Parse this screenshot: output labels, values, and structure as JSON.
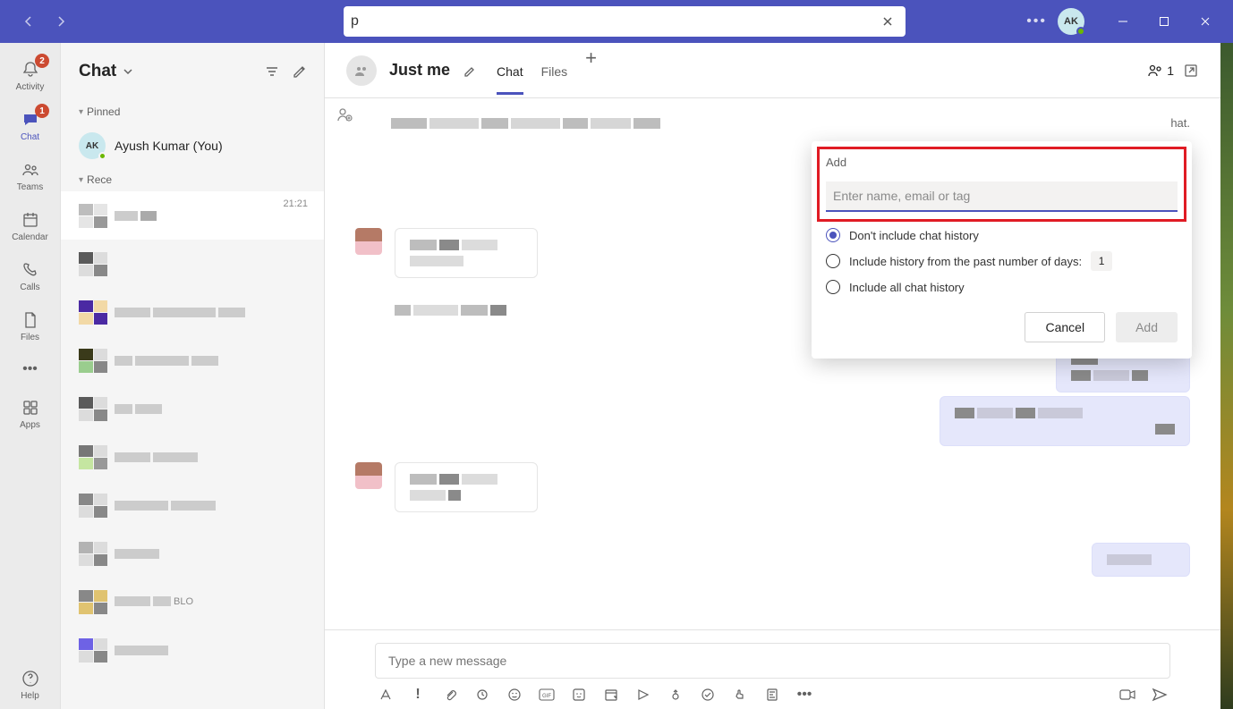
{
  "titlebar": {
    "search_value": "p",
    "avatar_initials": "AK"
  },
  "rail": {
    "activity": {
      "label": "Activity",
      "badge": "2"
    },
    "chat": {
      "label": "Chat",
      "badge": "1"
    },
    "teams": {
      "label": "Teams"
    },
    "calendar": {
      "label": "Calendar"
    },
    "calls": {
      "label": "Calls"
    },
    "files": {
      "label": "Files"
    },
    "apps": {
      "label": "Apps"
    },
    "help": {
      "label": "Help"
    }
  },
  "chatlist": {
    "title": "Chat",
    "pinned_label": "Pinned",
    "recent_label": "Rece",
    "pinned_item_name": "Ayush Kumar (You)",
    "pinned_avatar_initials": "AK",
    "selected_time": "21:21",
    "recent_fragment": "BLO"
  },
  "conversation": {
    "title": "Just me",
    "tabs": {
      "chat": "Chat",
      "files": "Files"
    },
    "participant_count": "1",
    "suffix_text": "hat."
  },
  "compose": {
    "placeholder": "Type a new message"
  },
  "add_people": {
    "title": "Add",
    "placeholder": "Enter name, email or tag",
    "opt_none": "Don't include chat history",
    "opt_days_prefix": "Include history from the past number of days:",
    "days_value": "1",
    "opt_all": "Include all chat history",
    "cancel": "Cancel",
    "add": "Add"
  }
}
